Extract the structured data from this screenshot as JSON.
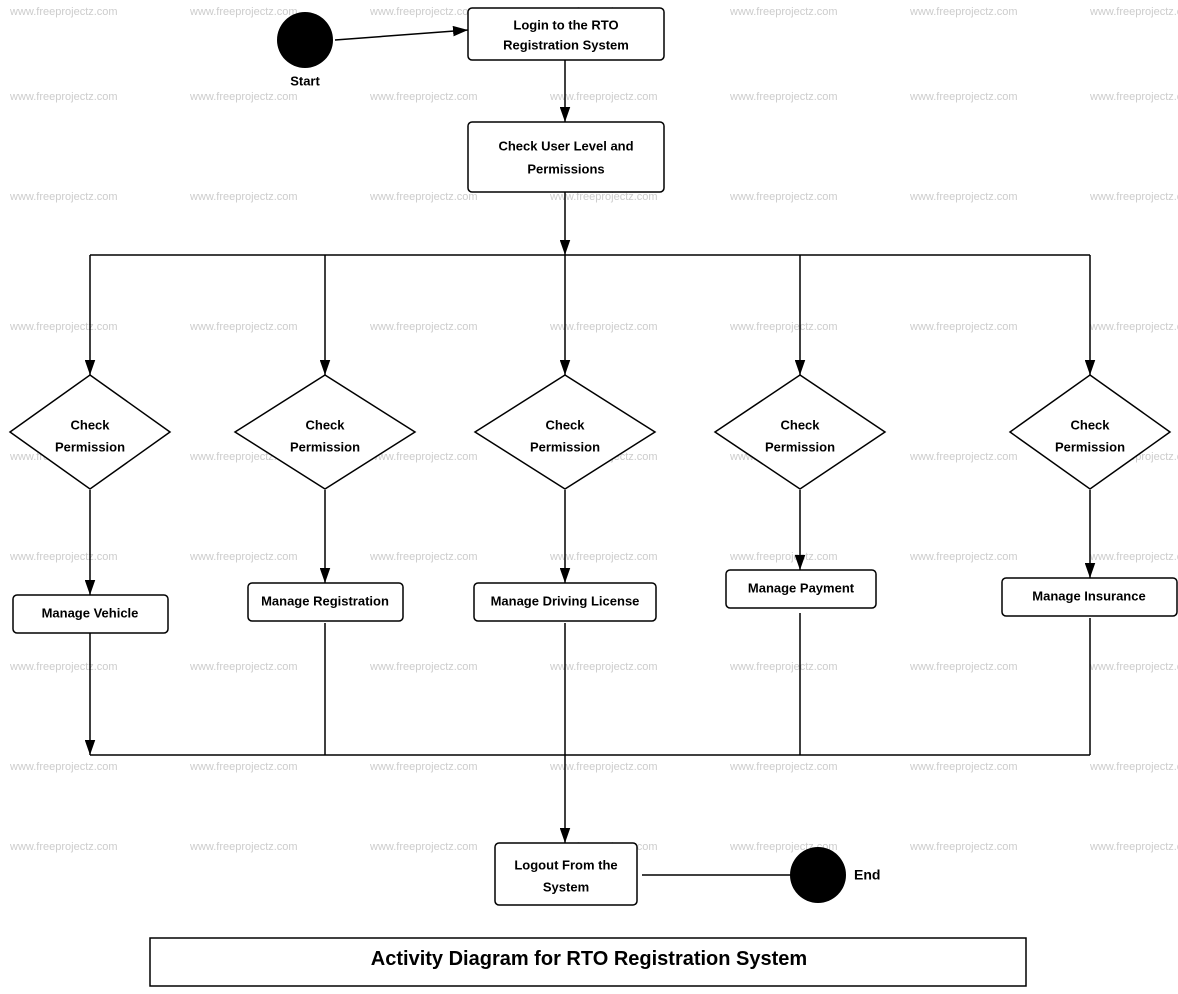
{
  "diagram": {
    "title": "Activity Diagram for RTO Registration System",
    "nodes": {
      "start_label": "Start",
      "login_label": "Login to the RTO\nRegistration System",
      "check_user_label": "Check User Level and\nPermissions",
      "check_perm1": "Check\nPermission",
      "check_perm2": "Check\nPermission",
      "check_perm3": "Check\nPermission",
      "check_perm4": "Check\nPermission",
      "check_perm5": "Check\nPermission",
      "manage_vehicle": "Manage Vehicle",
      "manage_registration": "Manage Registration",
      "manage_driving": "Manage Driving License",
      "manage_payment": "Manage Payment",
      "manage_insurance": "Manage Insurance",
      "logout_label": "Logout From the\nSystem",
      "end_label": "End"
    },
    "watermark": "www.freeprojectz.com"
  }
}
